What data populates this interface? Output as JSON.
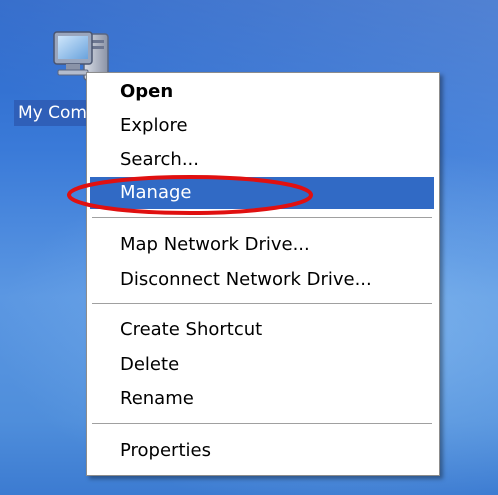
{
  "desktop": {
    "icon": {
      "label": "My Computer",
      "icon_name": "my-computer-icon"
    }
  },
  "context_menu": {
    "items": [
      {
        "label": "Open",
        "bold": true
      },
      {
        "label": "Explore"
      },
      {
        "label": "Search..."
      },
      {
        "label": "Manage",
        "selected": true
      },
      {
        "label": "Map Network Drive..."
      },
      {
        "label": "Disconnect Network Drive..."
      },
      {
        "label": "Create Shortcut"
      },
      {
        "label": "Delete"
      },
      {
        "label": "Rename"
      },
      {
        "label": "Properties"
      }
    ]
  },
  "annotation": {
    "type": "ellipse",
    "target": "Manage",
    "color": "#e01010"
  },
  "colors": {
    "selection": "#316ac5",
    "desktop_blue": "#3a7ad8"
  }
}
